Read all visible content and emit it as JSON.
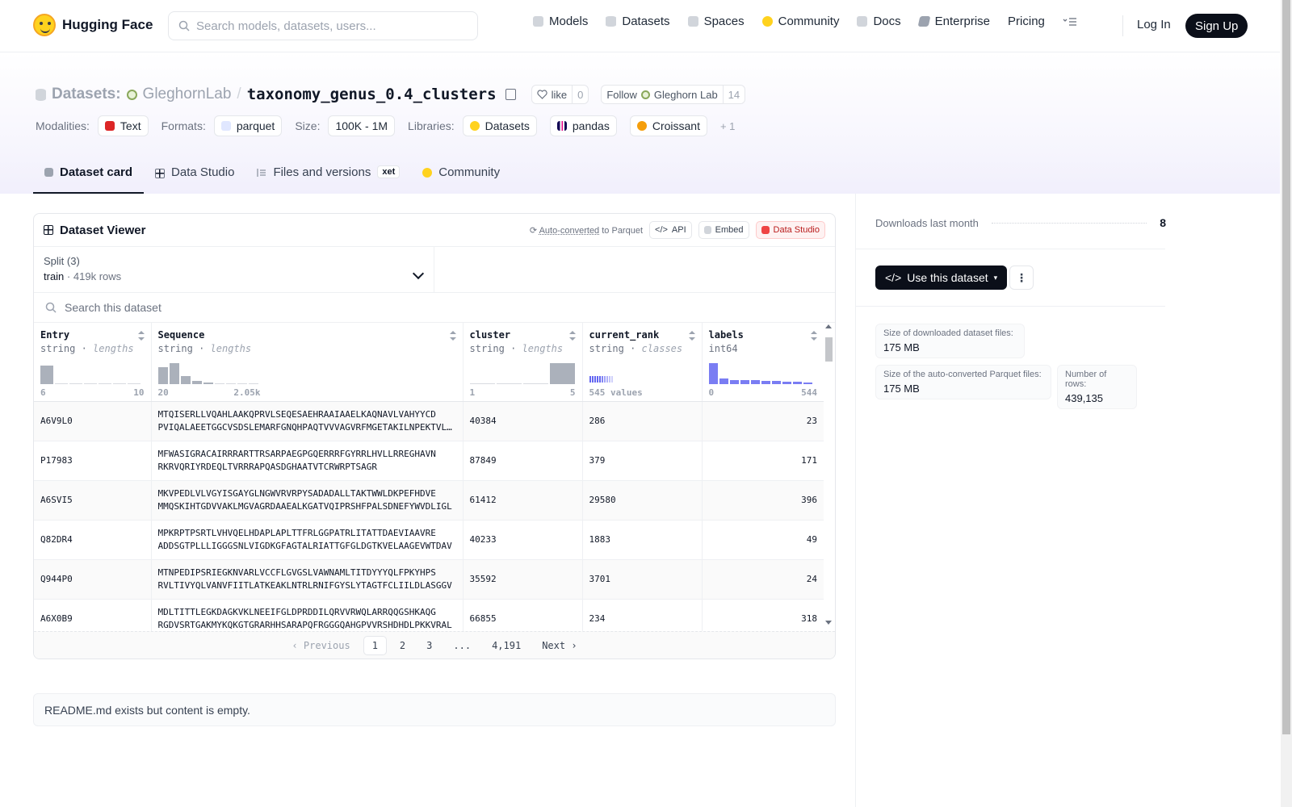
{
  "nav": {
    "brand": "Hugging Face",
    "search_placeholder": "Search models, datasets, users...",
    "links": [
      {
        "label": "Models",
        "icon": "models-icon",
        "color": "#e5e7eb"
      },
      {
        "label": "Datasets",
        "icon": "datasets-icon",
        "color": "#e5e7eb"
      },
      {
        "label": "Spaces",
        "icon": "spaces-icon",
        "color": "#e5e7eb"
      },
      {
        "label": "Community",
        "icon": "community-icon",
        "color": "#ffd21e"
      },
      {
        "label": "Docs",
        "icon": "docs-icon",
        "color": "#e5e7eb"
      },
      {
        "label": "Enterprise",
        "icon": "enterprise-icon",
        "color": "#9ca3af"
      },
      {
        "label": "Pricing"
      }
    ],
    "login": "Log In",
    "signup": "Sign Up"
  },
  "header": {
    "crumb_label": "Datasets:",
    "org": "GleghornLab",
    "slash": "/",
    "repo": "taxonomy_genus_0.4_clusters",
    "like_label": "like",
    "like_count": "0",
    "follow_label": "Follow",
    "follow_org": "Gleghorn Lab",
    "follow_count": "14",
    "modalities_label": "Modalities:",
    "modality": "Text",
    "formats_label": "Formats:",
    "format": "parquet",
    "size_label": "Size:",
    "size": "100K - 1M",
    "libraries_label": "Libraries:",
    "libraries": [
      "Datasets",
      "pandas",
      "Croissant"
    ],
    "libraries_more": "+ 1"
  },
  "tabs": [
    {
      "label": "Dataset card",
      "active": true,
      "icon": "dataset-card-icon"
    },
    {
      "label": "Data Studio",
      "icon": "table-icon"
    },
    {
      "label": "Files and versions",
      "icon": "files-icon",
      "badge": "xet"
    },
    {
      "label": "Community",
      "icon": "community-icon"
    }
  ],
  "viewer": {
    "title": "Dataset Viewer",
    "auto_converted": "Auto-converted",
    "to_parquet": "to Parquet",
    "api": "API",
    "embed": "Embed",
    "data_studio": "Data Studio",
    "split_label": "Split (3)",
    "split_value": "train",
    "split_dot": "·",
    "split_rows": "419k rows",
    "search_placeholder": "Search this dataset",
    "columns": [
      {
        "name": "Entry",
        "type": "string",
        "sub": "lengths",
        "min": "6",
        "max": "10",
        "hist": [
          0.9,
          0,
          0,
          0,
          0,
          0.05,
          0.05
        ]
      },
      {
        "name": "Sequence",
        "type": "string",
        "sub": "lengths",
        "min": "20",
        "max": "2.05k",
        "hist": [
          0.8,
          1.0,
          0.4,
          0.15,
          0.08,
          0.05,
          0.04,
          0.04,
          0.04
        ]
      },
      {
        "name": "cluster",
        "type": "string",
        "sub": "lengths",
        "min": "1",
        "max": "5",
        "hist": [
          0.04,
          0.04,
          0.04,
          1.0
        ]
      },
      {
        "name": "current_rank",
        "type": "string",
        "sub": "classes",
        "min": "545 values",
        "max": ""
      },
      {
        "name": "labels",
        "type": "int64",
        "sub": "",
        "min": "0",
        "max": "544",
        "hist": [
          1.0,
          0.25,
          0.2,
          0.18,
          0.18,
          0.16,
          0.15,
          0.12,
          0.1,
          0.08
        ]
      }
    ],
    "rows": [
      {
        "entry": "A6V9L0",
        "seq1": "MTQISERLLVQAHLAAKQPRVLSEQESAEHRAAIAAELKAQNAVLVAHYYCD",
        "seq2": "PVIQALAEETGGCVSDSLEMARFGNQHPAQTVVVAGVRFMGETAKILNPEKTVLLPT",
        "cluster": "40384",
        "rank": "286",
        "label": "23"
      },
      {
        "entry": "P17983",
        "seq1": "MFWASIGRACAIRRRARTTRSARPAEGPGQERRRFGYRRLHVLLRREGHAVN",
        "seq2": "RKRVQRIYRDEQLTVRRRAPQASDGHAATVTCRWRPTSAGR",
        "cluster": "87849",
        "rank": "379",
        "label": "171"
      },
      {
        "entry": "A6SVI5",
        "seq1": "MKVPEDLVLVGYISGAYGLNGWVRVRPYSADADALLTAKTWWLDKPEFHDVE",
        "seq2": "MMQSKIHTGDVVAKLMGVAGRDAAEALKGATVQIPRSHFPALSDNEFYWVDLIGL",
        "cluster": "61412",
        "rank": "29580",
        "label": "396"
      },
      {
        "entry": "Q82DR4",
        "seq1": "MPKRPTPSRTLVHVQELHDAPLAPLTTFRLGGPATRLITATTDAEVIAAVRE",
        "seq2": "ADDSGTPLLLIGGGSNLVIGDKGFAGTALRIATTGFGLDGTKVELAAGEVWTDAV",
        "cluster": "40233",
        "rank": "1883",
        "label": "49"
      },
      {
        "entry": "Q944P0",
        "seq1": "MTNPEDIPSRIEGKNVARLVCCFLGVGSLVAWNAMLTITDYYYQLFPKYHPS",
        "seq2": "RVLTIVYQLVANVFIITLATKEAKLNTRLRNIFGYSLYTAGTFCLIILDLASGGV",
        "cluster": "35592",
        "rank": "3701",
        "label": "24"
      },
      {
        "entry": "A6X0B9",
        "seq1": "MDLTITTLEGKDAGKVKLNEEIFGLDPRDDILQRVVRWQLARRQQGSHKAQG",
        "seq2": "RGDVSRTGAKMYKQKGTGRARHHSARAPQFRGGGQAHGPVVRSHDHDLPKKVRAL",
        "cluster": "66855",
        "rank": "234",
        "label": "318"
      }
    ],
    "pager": {
      "prev": "Previous",
      "pages": [
        "1",
        "2",
        "3",
        "...",
        "4,191"
      ],
      "next": "Next"
    }
  },
  "readme": "README.md exists but content is empty.",
  "sidebar": {
    "downloads_label": "Downloads last month",
    "downloads_value": "8",
    "use_button": "Use this dataset",
    "stats": [
      {
        "k": "Size of downloaded dataset files:",
        "v": "175 MB"
      },
      {
        "k": "Size of the auto-converted Parquet files:",
        "v": "175 MB"
      },
      {
        "k": "Number of rows:",
        "v": "439,135"
      }
    ]
  }
}
